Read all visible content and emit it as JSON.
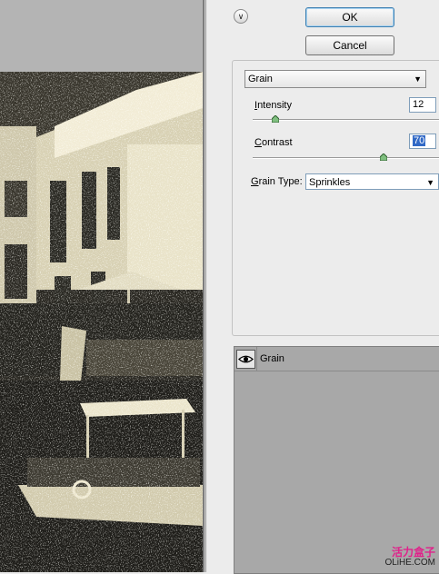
{
  "buttons": {
    "ok": "OK",
    "cancel": "Cancel"
  },
  "filter": {
    "selected": "Grain",
    "intensity": {
      "label_mnemonic": "I",
      "label_rest": "ntensity",
      "value": "12",
      "slider_fraction": 0.12
    },
    "contrast": {
      "label_mnemonic": "C",
      "label_rest": "ontrast",
      "value": "70",
      "slider_fraction": 0.7
    },
    "grain_type": {
      "label_mnemonic": "G",
      "label_rest": "rain Type:",
      "value": "Sprinkles"
    }
  },
  "layers": [
    {
      "name": "Grain",
      "visible": true
    }
  ],
  "watermark": {
    "cn": "活力盒子",
    "en": "OLiHE.COM",
    "color": "#e0218a"
  },
  "icons": {
    "collapse": "double-chevron-down-icon",
    "eye": "eye-icon",
    "dropdown": "triangle-down-icon"
  }
}
